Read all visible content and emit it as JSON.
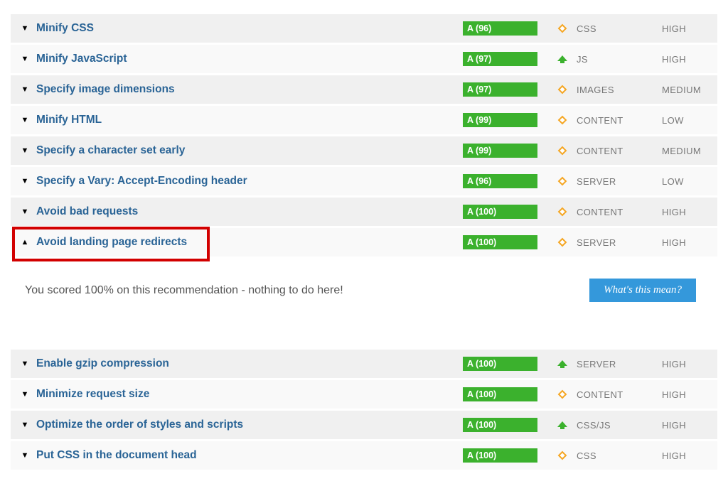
{
  "rows": [
    {
      "name": "Minify CSS",
      "grade": "A (96)",
      "trend": "diamond",
      "type": "CSS",
      "priority": "HIGH",
      "toggle": "down",
      "bg": "odd",
      "highlight": false
    },
    {
      "name": "Minify JavaScript",
      "grade": "A (97)",
      "trend": "up",
      "type": "JS",
      "priority": "HIGH",
      "toggle": "down",
      "bg": "even",
      "highlight": false
    },
    {
      "name": "Specify image dimensions",
      "grade": "A (97)",
      "trend": "diamond",
      "type": "IMAGES",
      "priority": "MEDIUM",
      "toggle": "down",
      "bg": "odd",
      "highlight": false
    },
    {
      "name": "Minify HTML",
      "grade": "A (99)",
      "trend": "diamond",
      "type": "CONTENT",
      "priority": "LOW",
      "toggle": "down",
      "bg": "even",
      "highlight": false
    },
    {
      "name": "Specify a character set early",
      "grade": "A (99)",
      "trend": "diamond",
      "type": "CONTENT",
      "priority": "MEDIUM",
      "toggle": "down",
      "bg": "odd",
      "highlight": false
    },
    {
      "name": "Specify a Vary: Accept-Encoding header",
      "grade": "A (96)",
      "trend": "diamond",
      "type": "SERVER",
      "priority": "LOW",
      "toggle": "down",
      "bg": "even",
      "highlight": false
    },
    {
      "name": "Avoid bad requests",
      "grade": "A (100)",
      "trend": "diamond",
      "type": "CONTENT",
      "priority": "HIGH",
      "toggle": "down",
      "bg": "odd",
      "highlight": false
    },
    {
      "name": "Avoid landing page redirects",
      "grade": "A (100)",
      "trend": "diamond",
      "type": "SERVER",
      "priority": "HIGH",
      "toggle": "up",
      "bg": "even",
      "highlight": true
    }
  ],
  "expanded": {
    "message": "You scored 100% on this recommendation - nothing to do here!",
    "button": "What's this mean?"
  },
  "rows2": [
    {
      "name": "Enable gzip compression",
      "grade": "A (100)",
      "trend": "up",
      "type": "SERVER",
      "priority": "HIGH",
      "toggle": "down",
      "bg": "odd"
    },
    {
      "name": "Minimize request size",
      "grade": "A (100)",
      "trend": "diamond",
      "type": "CONTENT",
      "priority": "HIGH",
      "toggle": "down",
      "bg": "even"
    },
    {
      "name": "Optimize the order of styles and scripts",
      "grade": "A (100)",
      "trend": "up",
      "type": "CSS/JS",
      "priority": "HIGH",
      "toggle": "down",
      "bg": "odd"
    },
    {
      "name": "Put CSS in the document head",
      "grade": "A (100)",
      "trend": "diamond",
      "type": "CSS",
      "priority": "HIGH",
      "toggle": "down",
      "bg": "even"
    }
  ]
}
